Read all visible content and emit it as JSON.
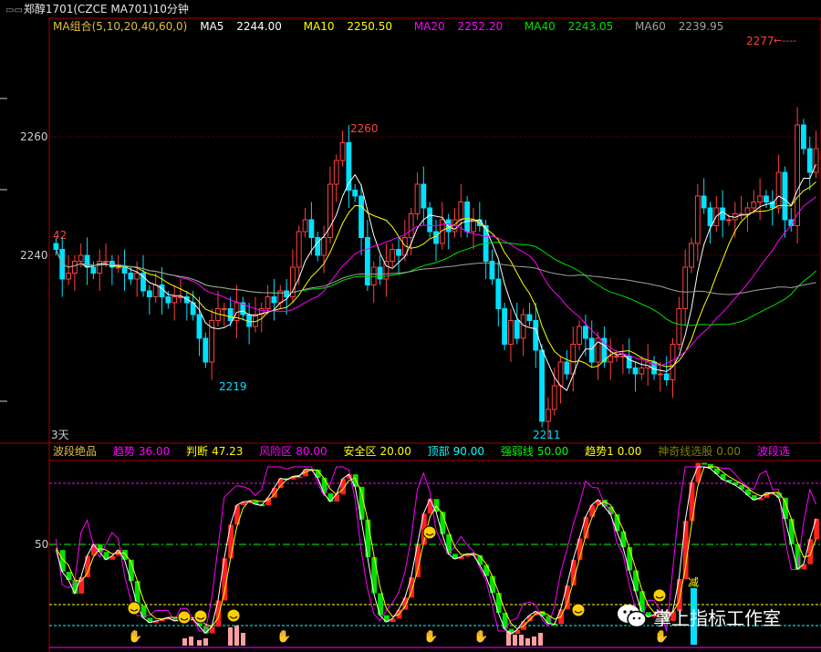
{
  "window": {
    "title": "郑醇1701(CZCE MA701)10分钟"
  },
  "ma_legend": {
    "group": {
      "label": "MA组合(5,10,20,40,60,0)",
      "color": "#e0c040"
    },
    "items": [
      {
        "label": "MA5",
        "value": "2244.00",
        "color": "#ffffff"
      },
      {
        "label": "MA10",
        "value": "2250.50",
        "color": "#ffff00"
      },
      {
        "label": "MA20",
        "value": "2252.20",
        "color": "#ff00ff"
      },
      {
        "label": "MA40",
        "value": "2243.05",
        "color": "#00e000"
      },
      {
        "label": "MA60",
        "value": "2239.95",
        "color": "#a0a0a0"
      }
    ]
  },
  "price_axis": {
    "labels": [
      "2260",
      "2240"
    ],
    "high_marker": "2277",
    "left_marker": "42",
    "period_label": "3天"
  },
  "candle_annotations": [
    "2260",
    "2219",
    "2211"
  ],
  "indicator_legend": {
    "name": "波段绝品",
    "items": [
      {
        "label": "趋势",
        "value": "36.00",
        "color": "#ff00ff"
      },
      {
        "label": "判断",
        "value": "47.23",
        "color": "#ffff00"
      },
      {
        "label": "风险区",
        "value": "80.00",
        "color": "#ff00ff"
      },
      {
        "label": "安全区",
        "value": "20.00",
        "color": "#ffff00"
      },
      {
        "label": "顶部",
        "value": "90.00",
        "color": "#00ffff"
      },
      {
        "label": "强弱线",
        "value": "50.00",
        "color": "#00ff00"
      },
      {
        "label": "趋势1",
        "value": "0.00",
        "color": "#ffff00"
      },
      {
        "label": "神奇线选股",
        "value": "0.00",
        "color": "#808000"
      },
      {
        "label": "波段选",
        "value": "",
        "color": "#ff00ff"
      }
    ]
  },
  "indicator_axis": {
    "label": "50"
  },
  "indicator_marks": {
    "buy_label": "减"
  },
  "watermark": {
    "text": "掌上指标工作室"
  },
  "colors": {
    "up": "#ff4040",
    "down": "#00e0ff",
    "grid_red": "#a00000",
    "axis": "#c00000"
  }
}
